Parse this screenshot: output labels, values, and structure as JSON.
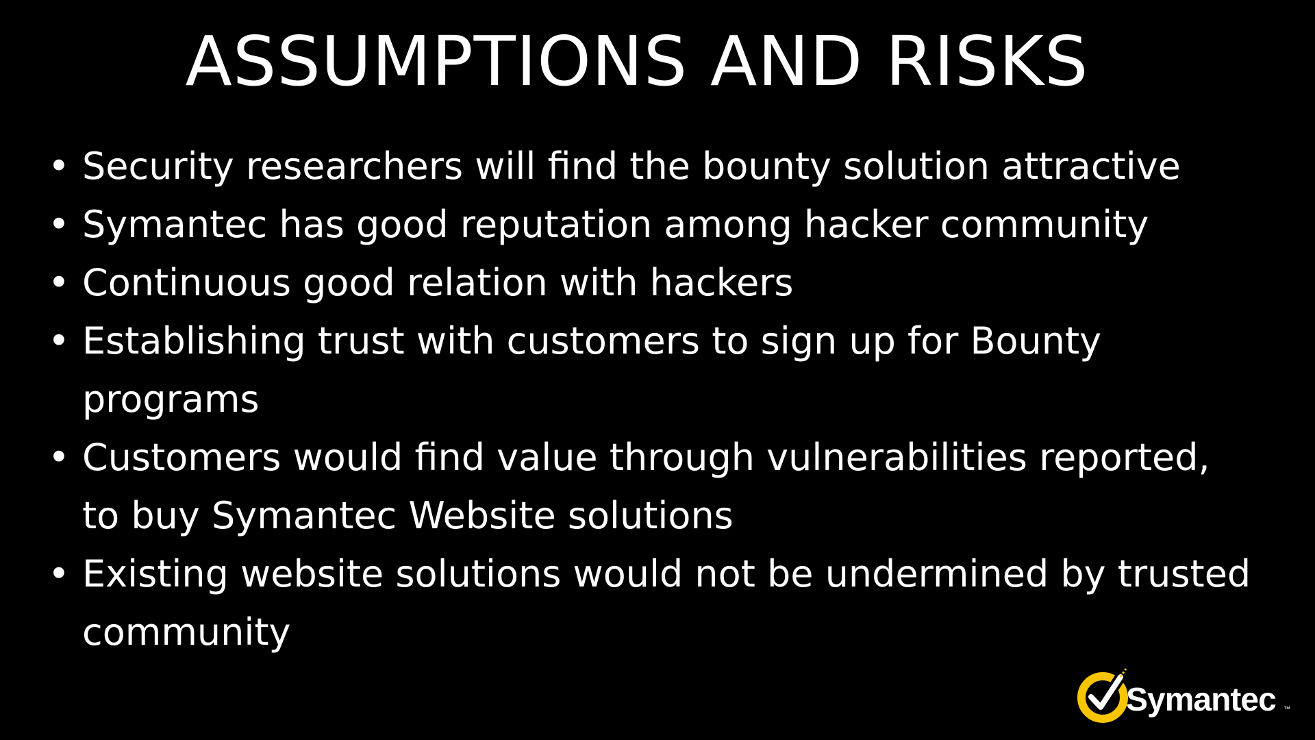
{
  "slide": {
    "title": "ASSUMPTIONS AND RISKS",
    "bullets": [
      "Security researchers will find the bounty solution attractive",
      "Symantec has good reputation among hacker community",
      "Continuous good relation with hackers",
      "Establishing trust with customers to sign up for Bounty programs",
      "Customers would find value through vulnerabilities reported, to buy Symantec Website solutions",
      "Existing website solutions would not be undermined by trusted community"
    ],
    "bullet_glyph": "•"
  },
  "logo": {
    "wordmark": "Symantec",
    "trademark": "™",
    "icon": "checkmark-circle-icon",
    "accent_color": "#F7C600",
    "text_color": "#FFFFFF"
  },
  "theme": {
    "background": "#000000",
    "text_color": "#FFFFFF"
  }
}
